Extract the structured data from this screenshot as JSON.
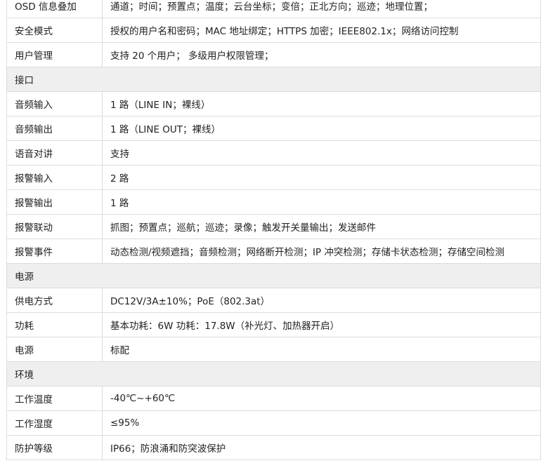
{
  "rows": [
    {
      "kind": "row",
      "label": "OSD 信息叠加",
      "value": "通道；时间；预置点；温度；云台坐标；变倍；正北方向；巡迹；地理位置；"
    },
    {
      "kind": "row",
      "label": "安全模式",
      "value": "授权的用户名和密码；MAC 地址绑定；HTTPS 加密；IEEE802.1x；网络访问控制"
    },
    {
      "kind": "row",
      "label": "用户管理",
      "value": "支持 20 个用户；  多级用户权限管理；"
    },
    {
      "kind": "section",
      "label": "接口"
    },
    {
      "kind": "row",
      "label": "音频输入",
      "value": "1 路（LINE IN；裸线）"
    },
    {
      "kind": "row",
      "label": "音频输出",
      "value": "1 路（LINE OUT；裸线）"
    },
    {
      "kind": "row",
      "label": "语音对讲",
      "value": "支持"
    },
    {
      "kind": "row",
      "label": "报警输入",
      "value": "2 路"
    },
    {
      "kind": "row",
      "label": "报警输出",
      "value": "1 路"
    },
    {
      "kind": "row",
      "label": "报警联动",
      "value": "抓图；预置点；巡航；巡迹；录像；触发开关量输出；发送邮件"
    },
    {
      "kind": "row",
      "label": "报警事件",
      "value": "动态检测/视频遮挡；音频检测；网络断开检测；IP 冲突检测；存储卡状态检测；存储空间检测"
    },
    {
      "kind": "section",
      "label": "电源"
    },
    {
      "kind": "row",
      "label": "供电方式",
      "value": "DC12V/3A±10%；PoE（802.3at）"
    },
    {
      "kind": "row",
      "label": "功耗",
      "value": "基本功耗：6W   功耗：17.8W（补光灯、加热器开启）"
    },
    {
      "kind": "row",
      "label": "电源",
      "value": "标配"
    },
    {
      "kind": "section",
      "label": "环境"
    },
    {
      "kind": "row",
      "label": "工作温度",
      "value": "-40℃~+60℃"
    },
    {
      "kind": "row",
      "label": "工作湿度",
      "value": "≤95%"
    },
    {
      "kind": "row",
      "label": "防护等级",
      "value": "IP66；防浪涌和防突波保护"
    }
  ]
}
